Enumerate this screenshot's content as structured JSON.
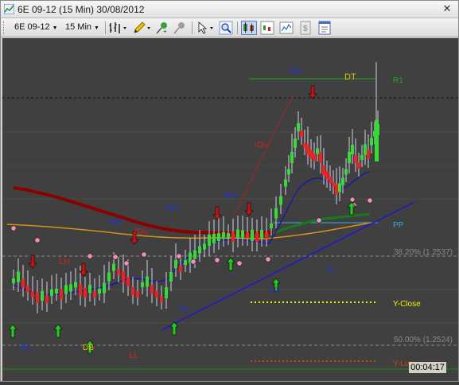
{
  "window": {
    "title": "6E 09-12 (15 Min)  30/08/2012",
    "close_glyph": "✕"
  },
  "toolbar": {
    "instrument": "6E 09-12",
    "interval": "15 Min",
    "tools": [
      "bar-type-icon",
      "pencil-icon",
      "pin-plus-icon",
      "pin-minus-icon",
      "cursor-icon",
      "zoom-icon",
      "chart-style-icon",
      "indicator-icon",
      "strategy-icon",
      "properties-icon"
    ]
  },
  "chart": {
    "annotations": {
      "hh_top": "HH",
      "dt": "DT",
      "r1": "R1",
      "rdiv_upper": "rDiv",
      "hh_mid1": "HH",
      "hh_mid2": "HH",
      "hh_left": "HH",
      "rdiv_lower": "rDiv",
      "lh": "LH",
      "pp": "PP",
      "fib_38": "38.20% (1.2537)",
      "hl_right": "HL",
      "hl_mid": "HL",
      "hl_left": "HL",
      "y_close": "Y-Close",
      "db": "DB",
      "ll": "LL",
      "fib_50": "50.00% (1.2524)",
      "y_low": "Y-Low",
      "hl_small": "HL"
    },
    "timer": "00:04:17",
    "colors": {
      "background": "#404040",
      "bull_candle": "#33dd33",
      "bear_candle": "#ee2222",
      "wick": "#cfcfe8",
      "sma_fast": "#1a1aa0",
      "sma_mid": "#1a7a1a",
      "sma_slow": "#8b0000",
      "ema_orange": "#d9901c",
      "trendline": "#1a1ad0",
      "r1_line": "#22aa22",
      "y_close_line": "#f0f000",
      "y_low_line": "#d04010",
      "pp_line": "#33aaee",
      "fib_line": "#8a8a8a",
      "hh_label": "#2233cc",
      "dt_label": "#e0c000",
      "lh_label": "#cc2222",
      "arrow_up": "#22cc22",
      "arrow_down": "#cc1111",
      "pivot_dot": "#f090b8"
    }
  }
}
